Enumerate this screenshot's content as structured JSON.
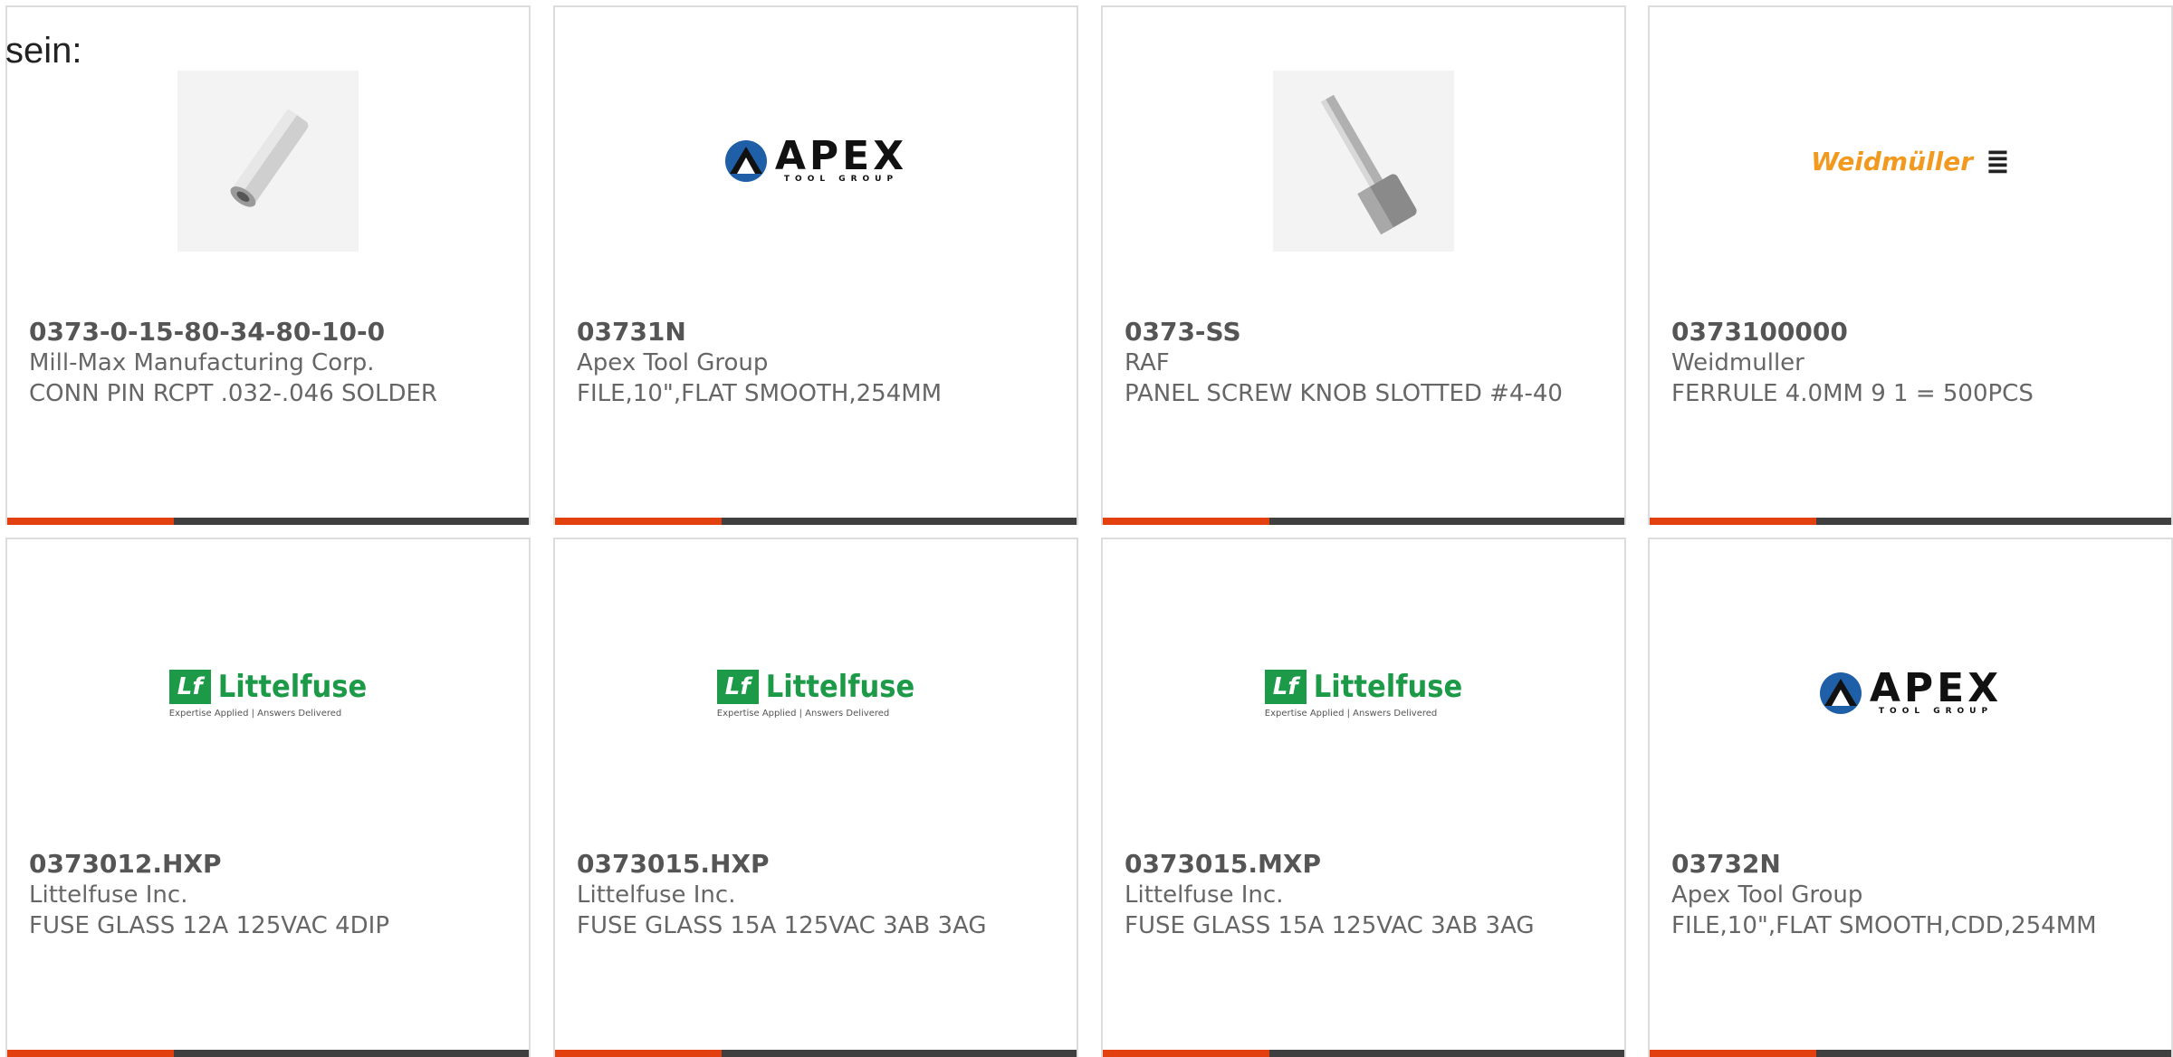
{
  "lead_text": "sein:",
  "products": [
    {
      "part_number": "0373-0-15-80-34-80-10-0",
      "manufacturer": "Mill-Max Manufacturing Corp.",
      "description": "CONN PIN RCPT .032-.046 SOLDER",
      "image": "pin-photo"
    },
    {
      "part_number": "03731N",
      "manufacturer": "Apex Tool Group",
      "description": "FILE,10\",FLAT SMOOTH,254MM",
      "image": "apex-logo"
    },
    {
      "part_number": "0373-SS",
      "manufacturer": "RAF",
      "description": "PANEL SCREW KNOB SLOTTED #4-40",
      "image": "screw-photo"
    },
    {
      "part_number": "0373100000",
      "manufacturer": "Weidmuller",
      "description": "FERRULE 4.0MM 9 1 = 500PCS",
      "image": "weidmuller-logo"
    },
    {
      "part_number": "0373012.HXP",
      "manufacturer": "Littelfuse Inc.",
      "description": "FUSE GLASS 12A 125VAC 4DIP",
      "image": "littelfuse-logo"
    },
    {
      "part_number": "0373015.HXP",
      "manufacturer": "Littelfuse Inc.",
      "description": "FUSE GLASS 15A 125VAC 3AB 3AG",
      "image": "littelfuse-logo"
    },
    {
      "part_number": "0373015.MXP",
      "manufacturer": "Littelfuse Inc.",
      "description": "FUSE GLASS 15A 125VAC 3AB 3AG",
      "image": "littelfuse-logo"
    },
    {
      "part_number": "03732N",
      "manufacturer": "Apex Tool Group",
      "description": "FILE,10\",FLAT SMOOTH,CDD,254MM",
      "image": "apex-logo"
    }
  ],
  "logos": {
    "apex": {
      "word": "APEX",
      "sub": "TOOL GROUP"
    },
    "weidmuller": {
      "word": "Weidmüller",
      "mark": "≣"
    },
    "littelfuse": {
      "box": "Lf",
      "word": "Littelfuse",
      "tagline": "Expertise Applied | Answers Delivered"
    }
  },
  "colors": {
    "accent": "#e2400f",
    "bar": "#3f3f3f",
    "apex_blue": "#1f5fa8",
    "weidmuller_orange": "#f29a1f",
    "littelfuse_green": "#1d9a48"
  }
}
